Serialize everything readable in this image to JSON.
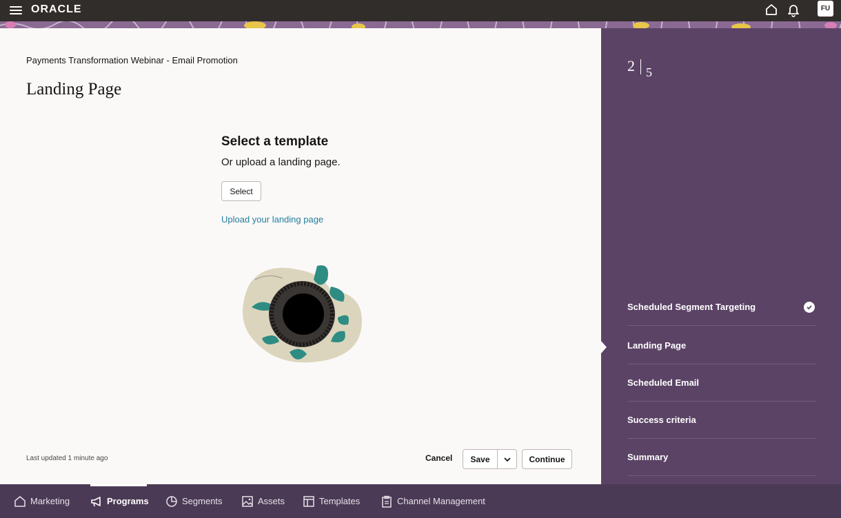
{
  "header": {
    "logo": "ORACLE",
    "avatar_initials": "FU"
  },
  "main": {
    "program_name": "Payments Transformation Webinar - Email Promotion",
    "page_title": "Landing Page",
    "template_title": "Select a template",
    "template_subtitle": "Or upload a landing page.",
    "select_label": "Select",
    "upload_link": "Upload your landing page",
    "last_updated": "Last updated 1 minute ago",
    "cancel_label": "Cancel",
    "save_label": "Save",
    "continue_label": "Continue"
  },
  "train": {
    "current_step": "2",
    "total_steps": "5",
    "steps": [
      {
        "label": "Scheduled Segment Targeting",
        "completed": true
      },
      {
        "label": "Landing Page",
        "current": true
      },
      {
        "label": "Scheduled Email"
      },
      {
        "label": "Success criteria"
      },
      {
        "label": "Summary"
      }
    ]
  },
  "bottom_nav": {
    "items": [
      {
        "label": "Marketing",
        "icon": "home-icon"
      },
      {
        "label": "Programs",
        "icon": "megaphone-icon",
        "active": true
      },
      {
        "label": "Segments",
        "icon": "pie-chart-icon"
      },
      {
        "label": "Assets",
        "icon": "image-icon"
      },
      {
        "label": "Templates",
        "icon": "template-icon"
      },
      {
        "label": "Channel Management",
        "icon": "clipboard-icon"
      }
    ]
  },
  "colors": {
    "top_bar": "#312d2a",
    "train_panel": "#5b4366",
    "bottom_nav": "#4b3a55",
    "link": "#227e9e"
  }
}
